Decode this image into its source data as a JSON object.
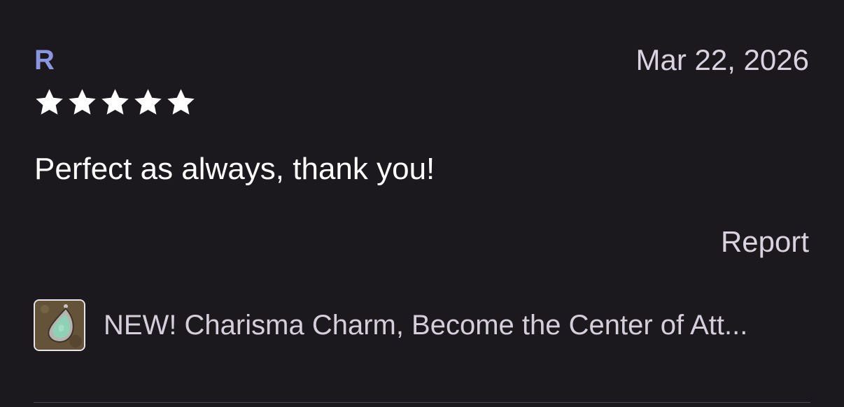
{
  "review": {
    "reviewer_initial": "R",
    "date": "Mar 22, 2026",
    "rating": 5,
    "rating_max": 5,
    "text": "Perfect as always, thank you!",
    "report_label": "Report"
  },
  "product": {
    "title": "NEW! Charisma Charm, Become the Center of Att...",
    "thumbnail_icon": "pendant-thumbnail"
  },
  "colors": {
    "background": "#1c191e",
    "initial": "#8a97e0",
    "star": "#ffffff",
    "muted_text": "#d8d3de"
  }
}
